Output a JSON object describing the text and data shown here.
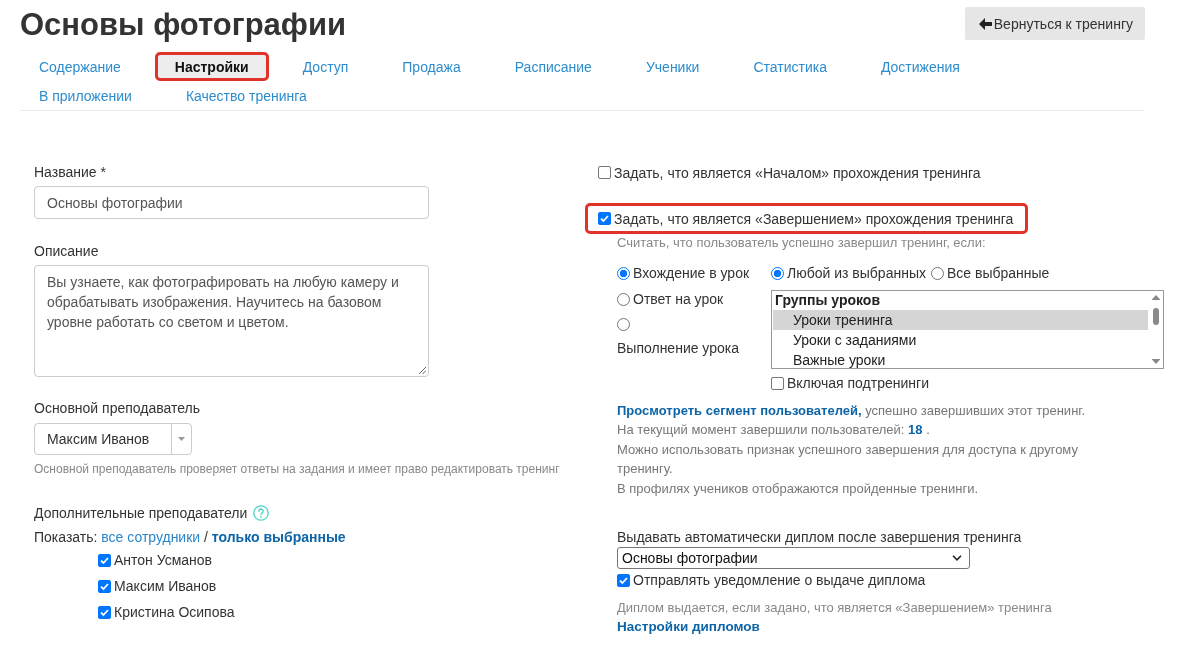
{
  "page_title": "Основы фотографии",
  "back_button": {
    "label": "Вернуться к тренингу"
  },
  "tabs": [
    {
      "label": "Содержание",
      "selected": false,
      "highlighted": false
    },
    {
      "label": "Настройки",
      "selected": true,
      "highlighted": true
    },
    {
      "label": "Доступ",
      "selected": false,
      "highlighted": false
    },
    {
      "label": "Продажа",
      "selected": false,
      "highlighted": false
    },
    {
      "label": "Расписание",
      "selected": false,
      "highlighted": false
    },
    {
      "label": "Ученики",
      "selected": false,
      "highlighted": false
    },
    {
      "label": "Статистика",
      "selected": false,
      "highlighted": false
    },
    {
      "label": "Достижения",
      "selected": false,
      "highlighted": false
    },
    {
      "label": "В приложении",
      "selected": false,
      "highlighted": false
    },
    {
      "label": "Качество тренинга",
      "selected": false,
      "highlighted": false
    }
  ],
  "general": {
    "name": {
      "label": "Название *",
      "value": "Основы фотографии"
    },
    "description": {
      "label": "Описание",
      "lines": [
        "Вы узнаете, как фотографировать на любую камеру и",
        "обрабатывать изображения. Научитесь на базовом",
        "уровне работать со светом и цветом."
      ]
    },
    "main_teacher": {
      "label": "Основной преподаватель",
      "value": "Максим Иванов",
      "hint": "Основной преподаватель проверяет ответы на задания и имеет право редактировать тренинг"
    },
    "extra_teachers": {
      "label": "Дополнительные преподаватели",
      "show_label": "Показать:",
      "separator": "/",
      "filters": [
        {
          "label": "все сотрудники",
          "selected": false
        },
        {
          "label": "только выбранные",
          "selected": true
        }
      ],
      "teachers": [
        {
          "name": "Антон Усманов",
          "checked": true
        },
        {
          "name": "Максим Иванов",
          "checked": true
        },
        {
          "name": "Кристина Осипова",
          "checked": true
        }
      ]
    }
  },
  "completion": {
    "start_option": {
      "label": "Задать, что является «Началом» прохождения тренинга",
      "checked": false,
      "highlighted": false
    },
    "finish_option": {
      "label": "Задать, что является «Завершением» прохождения тренинга",
      "checked": true,
      "highlighted": true
    },
    "criteria_hint": "Считать, что пользователь успешно завершил тренинг, если:",
    "events": [
      {
        "label": "Вхождение в урок",
        "selected": true,
        "kind": "inline"
      },
      {
        "label": "Ответ на урок",
        "selected": false,
        "kind": "inline"
      },
      {
        "label": "Выполнение урока",
        "selected": false,
        "kind": "stacked"
      }
    ],
    "match_modes": [
      {
        "label": "Любой из выбранных",
        "selected": true
      },
      {
        "label": "Все выбранные",
        "selected": false
      }
    ],
    "lesson_groups": {
      "heading": "Группы уроков",
      "items": [
        {
          "label": "Уроки тренинга",
          "selected": true
        },
        {
          "label": "Уроки с заданиями",
          "selected": false
        },
        {
          "label": "Важные уроки",
          "selected": false
        }
      ]
    },
    "include_subtrainings": {
      "label": "Включая подтренинги",
      "checked": false
    },
    "segment_link": "Просмотреть сегмент пользователей,",
    "segment_text": "успешно завершивших этот тренинг.",
    "count_label": "На текущий момент завершили пользователей:",
    "count": "18",
    "count_suffix": ".",
    "notes": [
      "Можно использовать признак успешного завершения для доступа к другому тренингу.",
      "В профилях учеников отображаются пройденные тренинги."
    ]
  },
  "diploma": {
    "label": "Выдавать автоматически диплом после завершения тренинга",
    "value": "Основы фотографии",
    "notify": {
      "label": "Отправлять уведомление о выдаче диплома",
      "checked": true
    },
    "hint": "Диплом выдается, если задано, что является «Завершением» тренинга",
    "settings_link": "Настройки дипломов"
  }
}
